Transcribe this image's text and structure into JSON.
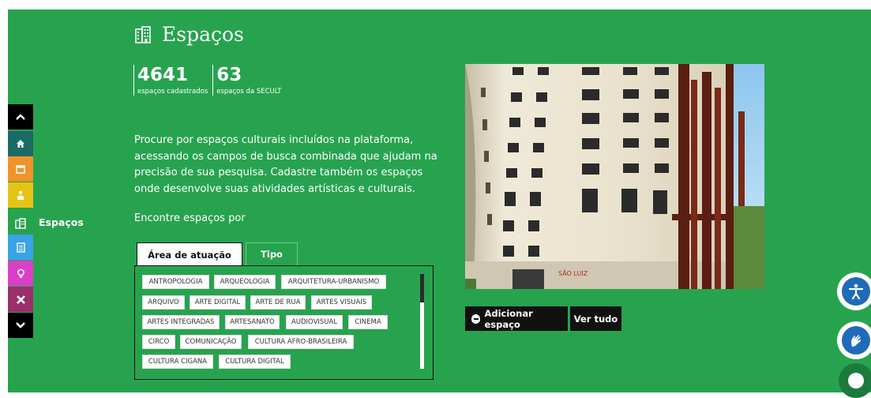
{
  "page": {
    "title": "Espaços",
    "title_icon": "building-icon",
    "accent_color": "#27a34f"
  },
  "stats": [
    {
      "value": "4641",
      "label": "espaços cadastrados"
    },
    {
      "value": "63",
      "label": "espaços da SECULT"
    }
  ],
  "description": "Procure por espaços culturais incluídos na plataforma, acessando os campos de busca combinada que ajudam na precisão de sua pesquisa. Cadastre também os espaços onde desenvolve suas atividades artísticas e culturais.",
  "find_by": "Encontre espaços por",
  "tabs": [
    {
      "label": "Área de atuação",
      "active": true
    },
    {
      "label": "Tipo",
      "active": false
    }
  ],
  "tags": [
    "ANTROPOLOGIA",
    "ARQUEOLOGIA",
    "ARQUITETURA-URBANISMO",
    "ARQUIVO",
    "ARTE DIGITAL",
    "ARTE DE RUA",
    "ARTES VISUAIS",
    "ARTES INTEGRADAS",
    "ARTESANATO",
    "AUDIOVISUAL",
    "CINEMA",
    "CIRCO",
    "COMUNICAÇÃO",
    "CULTURA AFRO-BRASILEIRA",
    "CULTURA CIGANA",
    "CULTURA DIGITAL"
  ],
  "photo_sign": "SÃO LUIZ",
  "actions": {
    "add_label": "Adicionar espaço",
    "all_label": "Ver tudo"
  },
  "nav": {
    "items": [
      {
        "name": "scroll-up",
        "icon": "chevron-up-icon",
        "color": "#000000"
      },
      {
        "name": "home",
        "icon": "home-icon",
        "color": "#1a6b66"
      },
      {
        "name": "events",
        "icon": "calendar-icon",
        "color": "#f0932b"
      },
      {
        "name": "agents",
        "icon": "person-icon",
        "color": "#e6c414"
      },
      {
        "name": "spaces",
        "icon": "building-icon",
        "color": "#27a34f"
      },
      {
        "name": "projects",
        "icon": "document-icon",
        "color": "#3aa3e6"
      },
      {
        "name": "opportunities",
        "icon": "lightbulb-icon",
        "color": "#d940c7"
      },
      {
        "name": "tools",
        "icon": "tools-icon",
        "color": "#9b2f6b"
      },
      {
        "name": "scroll-down",
        "icon": "chevron-down-icon",
        "color": "#000000"
      }
    ],
    "active_label": "Espaços"
  }
}
